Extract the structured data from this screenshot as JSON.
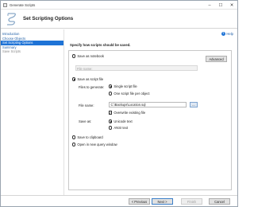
{
  "window": {
    "title": "Generate Scripts"
  },
  "header": {
    "title": "Set Scripting Options"
  },
  "nav": {
    "items": [
      {
        "label": "Introduction"
      },
      {
        "label": "Choose Objects"
      },
      {
        "label": "Set Scripting Options"
      },
      {
        "label": "Summary"
      },
      {
        "label": "Save Scripts"
      }
    ]
  },
  "main": {
    "help_label": "Help",
    "section_title": "Specify how scripts should be saved.",
    "save_as_notebook": {
      "label": "Save as notebook",
      "file_name_label": "File name:",
      "file_name_placeholder": ""
    },
    "advanced_label": "Advanced",
    "save_as_script_file": {
      "label": "Save as script file",
      "files_to_generate_label": "Files to generate:",
      "single_file_label": "Single script file",
      "one_per_object_label": "One script file per object",
      "file_name_label": "File name:",
      "file_name_value": "C:\\Backups\\Location.sql",
      "browse_label": "...",
      "overwrite_label": "Overwrite existing file",
      "save_as_label": "Save as:",
      "unicode_label": "Unicode text",
      "ansi_label": "ANSI text"
    },
    "save_to_clipboard_label": "Save to clipboard",
    "open_in_query_window_label": "Open in new query window"
  },
  "footer": {
    "previous_label": "< Previous",
    "next_label": "Next >",
    "finish_label": "Finish",
    "cancel_label": "Cancel"
  }
}
